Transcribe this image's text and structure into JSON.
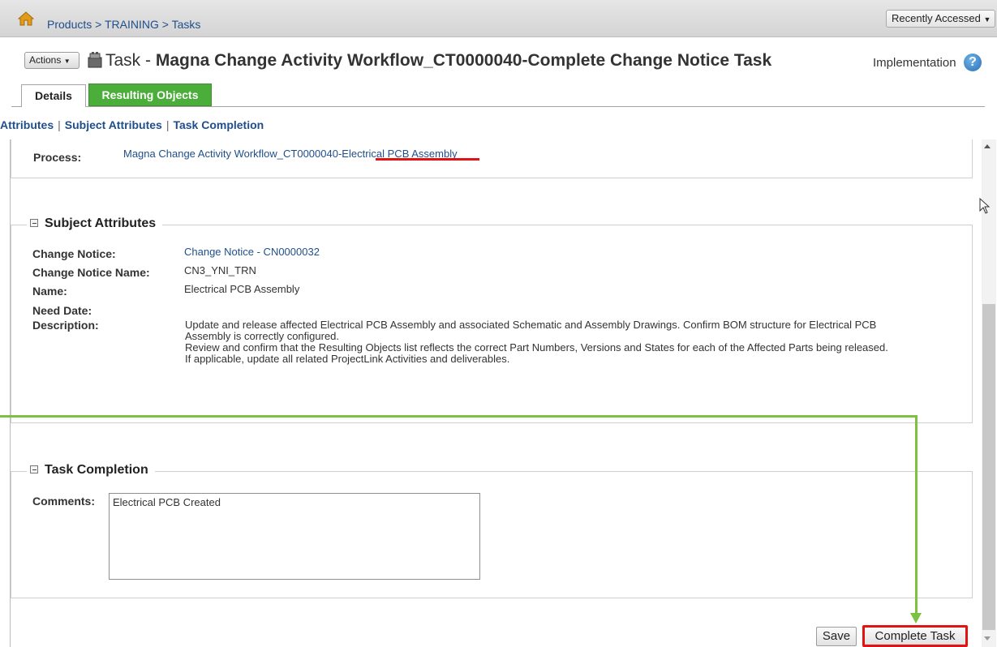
{
  "topbar": {
    "breadcrumb": [
      "Products",
      "TRAINING",
      "Tasks"
    ],
    "breadcrumb_sep": ">",
    "recently_accessed": "Recently Accessed"
  },
  "header": {
    "actions_label": "Actions",
    "title_prefix": "Task - ",
    "title": "Magna Change Activity Workflow_CT0000040-Complete Change Notice Task",
    "phase": "Implementation",
    "help": "?"
  },
  "tabs": [
    {
      "label": "Details",
      "active": true
    },
    {
      "label": "Resulting Objects",
      "active": false,
      "color": "#4cae3a"
    }
  ],
  "anchor_links": [
    "Attributes",
    "Subject Attributes",
    "Task Completion"
  ],
  "process": {
    "label": "Process:",
    "value": "Magna Change Activity Workflow_CT0000040-Electrical PCB Assembly"
  },
  "subject_attributes": {
    "heading": "Subject Attributes",
    "change_notice_label": "Change Notice:",
    "change_notice_value": "Change Notice - CN0000032",
    "change_notice_name_label": "Change Notice Name:",
    "change_notice_name_value": "CN3_YNI_TRN",
    "name_label": "Name:",
    "name_value": "Electrical PCB Assembly",
    "need_date_label": "Need Date:",
    "need_date_value": "",
    "description_label": "Description:",
    "description_lines": [
      "Update and release affected Electrical PCB Assembly and associated  Schematic and Assembly Drawings. Confirm BOM structure for Electrical PCB",
      "Assembly is correctly configured.",
      "Review and confirm that the Resulting Objects list reflects the correct Part Numbers, Versions and States for each of the Affected Parts being released.",
      "If applicable, update all related ProjectLink Activities and deliverables."
    ]
  },
  "task_completion": {
    "heading": "Task Completion",
    "comments_label": "Comments:",
    "comments_value": "Electrical PCB Created"
  },
  "buttons": {
    "save": "Save",
    "complete_task": "Complete Task"
  },
  "colors": {
    "link": "#1f4e8c",
    "tab_green": "#4cae3a",
    "highlight_red": "#e01414",
    "annotation_green": "#7dc142"
  }
}
